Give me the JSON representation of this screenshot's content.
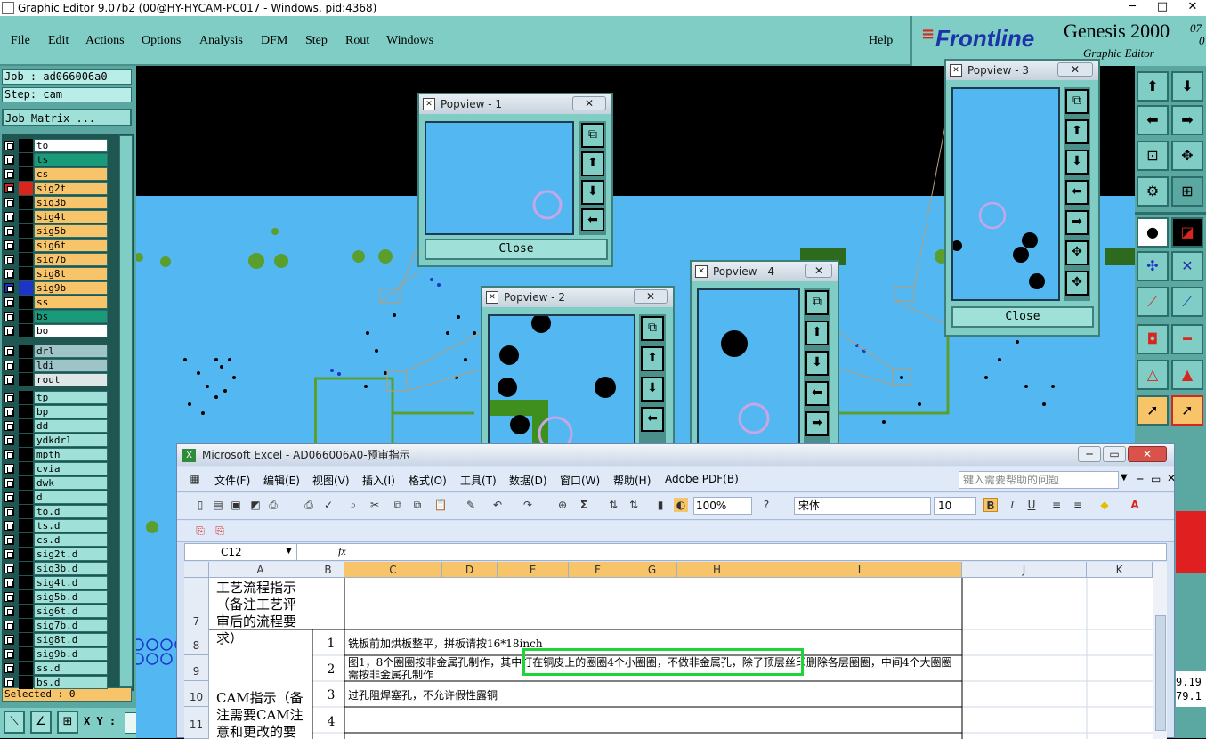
{
  "window": {
    "title": "Graphic Editor 9.07b2 (00@HY-HYCAM-PC017 - Windows, pid:4368)",
    "min": "─",
    "max": "□",
    "close": "✕"
  },
  "menu": [
    "File",
    "Edit",
    "Actions",
    "Options",
    "Analysis",
    "DFM",
    "Step",
    "Rout",
    "Windows"
  ],
  "help": "Help",
  "brand": {
    "logo": "Frontline",
    "product": "Genesis 2000",
    "sub": "Graphic Editor",
    "ver": "07",
    "ver2": "0"
  },
  "job": {
    "job": "Job : ad066006a0",
    "step": "Step: cam",
    "matrix": "Job Matrix ..."
  },
  "layers": [
    {
      "name": "to",
      "color": "#ffffff",
      "mark": ""
    },
    {
      "name": "ts",
      "color": "#1a9a78",
      "mark": ""
    },
    {
      "name": "cs",
      "color": "#f7c46a",
      "mark": ""
    },
    {
      "name": "sig2t",
      "color": "#f7c46a",
      "mark": "red"
    },
    {
      "name": "sig3b",
      "color": "#f7c46a",
      "mark": ""
    },
    {
      "name": "sig4t",
      "color": "#f7c46a",
      "mark": ""
    },
    {
      "name": "sig5b",
      "color": "#f7c46a",
      "mark": ""
    },
    {
      "name": "sig6t",
      "color": "#f7c46a",
      "mark": ""
    },
    {
      "name": "sig7b",
      "color": "#f7c46a",
      "mark": ""
    },
    {
      "name": "sig8t",
      "color": "#f7c46a",
      "mark": ""
    },
    {
      "name": "sig9b",
      "color": "#f7c46a",
      "mark": "blue"
    },
    {
      "name": "ss",
      "color": "#f7c46a",
      "mark": ""
    },
    {
      "name": "bs",
      "color": "#1a9a78",
      "mark": ""
    },
    {
      "name": "bo",
      "color": "#ffffff",
      "mark": ""
    }
  ],
  "layers2": [
    {
      "name": "drl",
      "color": "#9fc4c8"
    },
    {
      "name": "ldi",
      "color": "#9fc4c8"
    },
    {
      "name": "rout",
      "color": "#dfe6e6"
    }
  ],
  "layers3": [
    "tp",
    "bp",
    "dd",
    "ydkdrl",
    "mpth",
    "cvia",
    "dwk",
    "d",
    "to.d",
    "ts.d",
    "cs.d",
    "sig2t.d",
    "sig3b.d",
    "sig4t.d",
    "sig5b.d",
    "sig6t.d",
    "sig7b.d",
    "sig8t.d",
    "sig9b.d",
    "ss.d",
    "bs.d"
  ],
  "selected": "Selected : 0",
  "xy_label": "X Y :",
  "popviews": [
    {
      "title": "Popview - 1",
      "close": "Close"
    },
    {
      "title": "Popview - 2"
    },
    {
      "title": "Popview - 3",
      "close": "Close"
    },
    {
      "title": "Popview - 4"
    }
  ],
  "coords": [
    "9.19",
    "79.1"
  ],
  "excel": {
    "title": "Microsoft Excel - AD066006A0-预审指示",
    "menus": [
      "文件(F)",
      "编辑(E)",
      "视图(V)",
      "插入(I)",
      "格式(O)",
      "工具(T)",
      "数据(D)",
      "窗口(W)",
      "帮助(H)",
      "Adobe PDF(B)"
    ],
    "help_placeholder": "键入需要帮助的问题",
    "zoom": "100%",
    "font": "宋体",
    "size": "10",
    "bold": "B",
    "italic": "I",
    "underline": "U",
    "cellref": "C12",
    "fx": "fx",
    "columns": [
      "A",
      "B",
      "C",
      "D",
      "E",
      "F",
      "G",
      "H",
      "I",
      "J",
      "K"
    ],
    "rows": [
      {
        "num": "7",
        "a": "工艺流程指示（备注工艺评审后的流程要求）",
        "b": "",
        "c": ""
      },
      {
        "num": "8",
        "b": "1",
        "c": "铣板前加烘板整平，拼板请按16*18inch"
      },
      {
        "num": "9",
        "b": "2",
        "c": "图1，8个圈圈按非金属孔制作，其中打在铜皮上的圈圈4个小圈圈，不做非金属孔，除了顶层丝印删除各层圈圈，中间4个大圈圈需按非金属孔制作"
      },
      {
        "num": "10",
        "a": "CAM指示（备注需要CAM注意和更改的要",
        "b": "3",
        "c": "过孔阻焊塞孔，不允许假性露铜"
      },
      {
        "num": "11",
        "b": "4",
        "c": ""
      }
    ]
  }
}
